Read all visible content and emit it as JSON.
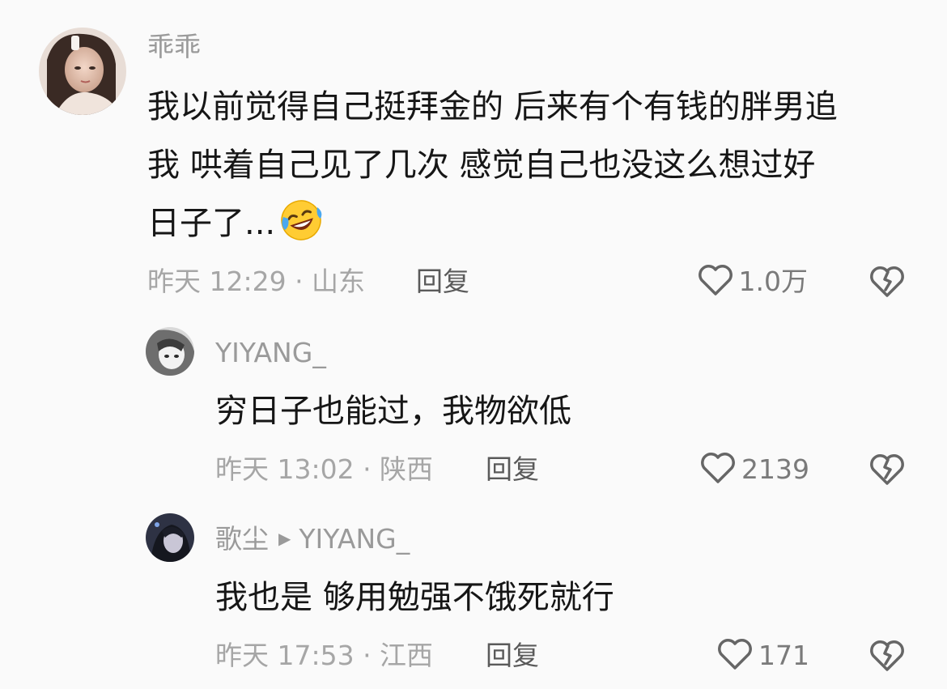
{
  "comments": [
    {
      "username": "乖乖",
      "text_lines": [
        "我以前觉得自己挺拜金的 后来有个有钱的胖男追",
        "我 哄着自己见了几次  感觉自己也没这么想过好",
        "日子了..."
      ],
      "emoji": "laughing-crying-emoji",
      "meta": "昨天 12:29 · 山东",
      "reply_label": "回复",
      "likes": "1.0万",
      "avatar": "avatar-woman-photo"
    },
    {
      "username": "YIYANG_",
      "text": "穷日子也能过，我物欲低",
      "meta": "昨天 13:02 · 陕西",
      "reply_label": "回复",
      "likes": "2139",
      "avatar": "avatar-anime-girl"
    },
    {
      "username": "歌尘",
      "reply_to": "YIYANG_",
      "text": "我也是 够用勉强不饿死就行",
      "meta": "昨天 17:53 · 江西",
      "reply_label": "回复",
      "likes": "171",
      "avatar": "avatar-dark-figure"
    }
  ],
  "icons": {
    "like": "heart-outline-icon",
    "dislike": "broken-heart-icon",
    "reply_arrow": "triangle-right-icon"
  },
  "colors": {
    "background": "#fafafa",
    "username": "#9a9a9a",
    "text": "#161616",
    "meta": "#a6a6a6",
    "icon": "#666666"
  }
}
